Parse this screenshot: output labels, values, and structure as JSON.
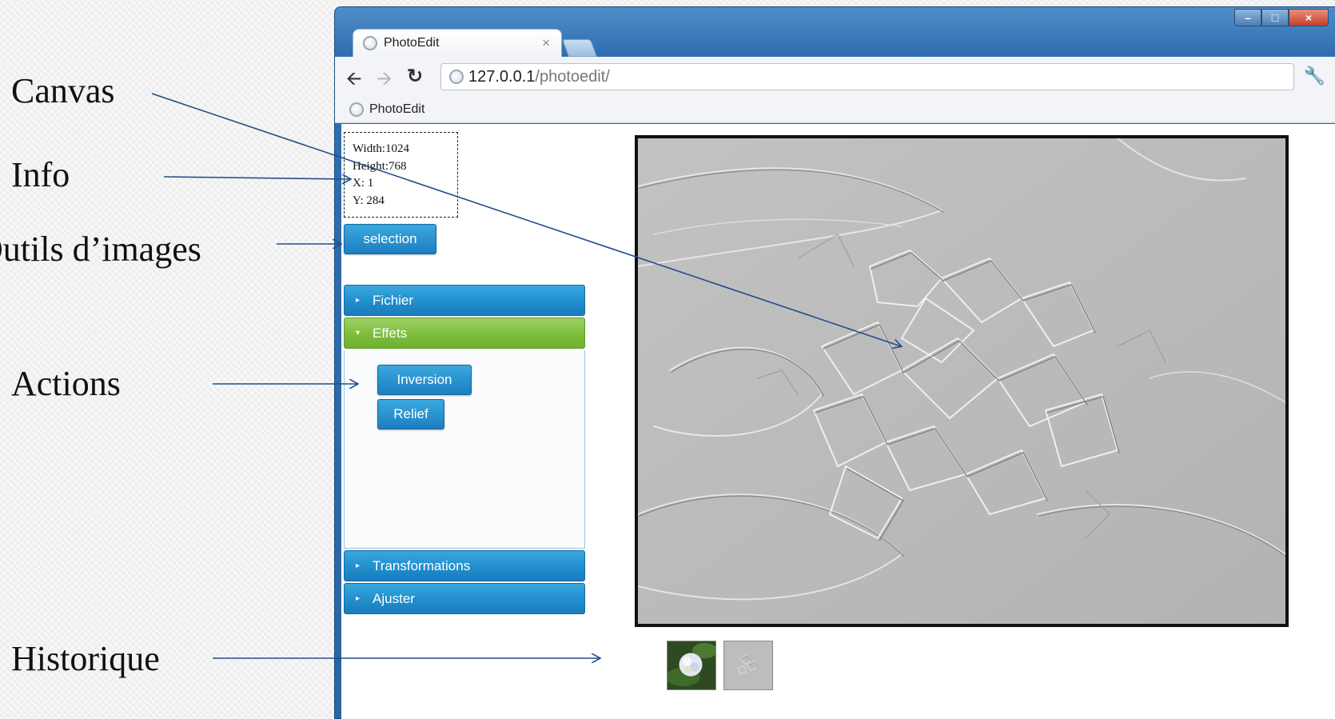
{
  "annotations": {
    "canvas": "Canvas",
    "info": "Info",
    "image_tools": "Outils d’images",
    "actions": "Actions",
    "history": "Historique"
  },
  "browser": {
    "tab_title": "PhotoEdit",
    "tab_close": "×",
    "url_host": "127.0.0.1",
    "url_path": "/photoedit/",
    "bookmark": "PhotoEdit",
    "window_controls": [
      "–",
      "□",
      "×"
    ]
  },
  "info": {
    "width": "Width:1024",
    "height": "Height:768",
    "x": "X: 1",
    "y": "Y: 284"
  },
  "tools": {
    "selection": "selection"
  },
  "accordion": {
    "fichier": "Fichier",
    "effets": "Effets",
    "transformations": "Transformations",
    "ajuster": "Ajuster"
  },
  "effects": {
    "inversion": "Inversion",
    "relief": "Relief"
  },
  "icons": {
    "back": "arrow-left-icon",
    "forward": "arrow-right-icon",
    "reload": "reload-icon",
    "wrench": "wrench-icon",
    "globe": "globe-icon"
  },
  "colors": {
    "button_blue": "#2290cf",
    "accordion_active_green": "#7fbf3e",
    "annotation_arrow": "#1f4e8a"
  }
}
